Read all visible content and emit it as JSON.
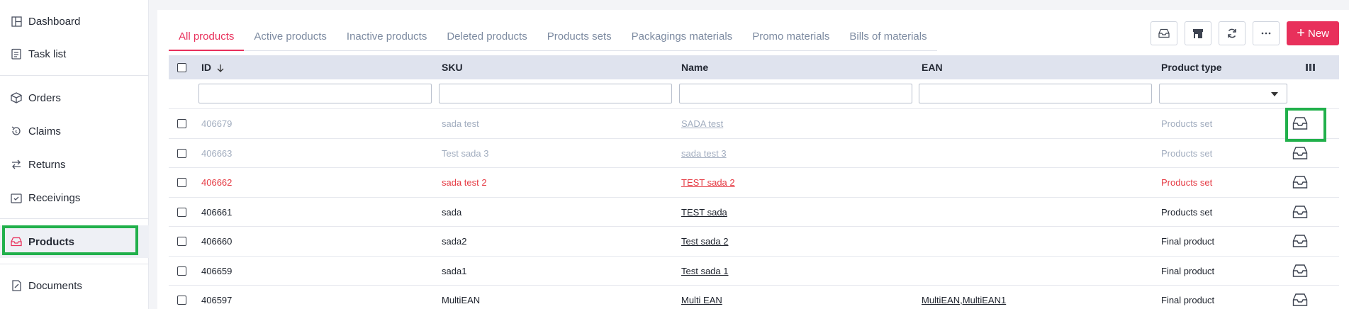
{
  "sidebar": {
    "items": [
      {
        "label": "Dashboard",
        "icon": "dashboard-icon"
      },
      {
        "label": "Task list",
        "icon": "task-list-icon"
      },
      {
        "label": "Orders",
        "icon": "box-icon"
      },
      {
        "label": "Claims",
        "icon": "claims-icon"
      },
      {
        "label": "Returns",
        "icon": "returns-icon"
      },
      {
        "label": "Receivings",
        "icon": "receivings-icon"
      },
      {
        "label": "Products",
        "icon": "inbox-icon",
        "active": true
      },
      {
        "label": "Documents",
        "icon": "document-icon"
      }
    ]
  },
  "tabs": [
    {
      "label": "All products",
      "active": true
    },
    {
      "label": "Active products"
    },
    {
      "label": "Inactive products"
    },
    {
      "label": "Deleted products"
    },
    {
      "label": "Products sets"
    },
    {
      "label": "Packagings materials"
    },
    {
      "label": "Promo materials"
    },
    {
      "label": "Bills of materials"
    }
  ],
  "toolbar": {
    "new_label": "New",
    "buttons": [
      "inbox-icon",
      "store-icon",
      "refresh-icon",
      "more-icon"
    ]
  },
  "table": {
    "columns": {
      "id": "ID",
      "sku": "SKU",
      "name": "Name",
      "ean": "EAN",
      "product_type": "Product type"
    },
    "rows": [
      {
        "id": "406679",
        "sku": "sada test",
        "name": "SADA test",
        "ean": "",
        "type": "Products set",
        "status": "inactive"
      },
      {
        "id": "406663",
        "sku": "Test sada 3",
        "name": "sada test 3",
        "ean": "",
        "type": "Products set",
        "status": "inactive"
      },
      {
        "id": "406662",
        "sku": "sada test 2",
        "name": "TEST sada 2",
        "ean": "",
        "type": "Products set",
        "status": "deleted"
      },
      {
        "id": "406661",
        "sku": "sada",
        "name": "TEST sada",
        "ean": "",
        "type": "Products set",
        "status": "normal"
      },
      {
        "id": "406660",
        "sku": "sada2",
        "name": "Test sada 2",
        "ean": "",
        "type": "Final product",
        "status": "normal"
      },
      {
        "id": "406659",
        "sku": "sada1",
        "name": "Test sada 1",
        "ean": "",
        "type": "Final product",
        "status": "normal"
      },
      {
        "id": "406597",
        "sku": "MultiEAN",
        "name": "Multi EAN",
        "ean": "MultiEAN,MultiEAN1",
        "type": "Final product",
        "status": "normal"
      }
    ]
  },
  "colors": {
    "accent": "#e8305b",
    "highlight": "#21b04b",
    "inactive_text": "#a2adbf",
    "deleted_text": "#e53a43"
  }
}
